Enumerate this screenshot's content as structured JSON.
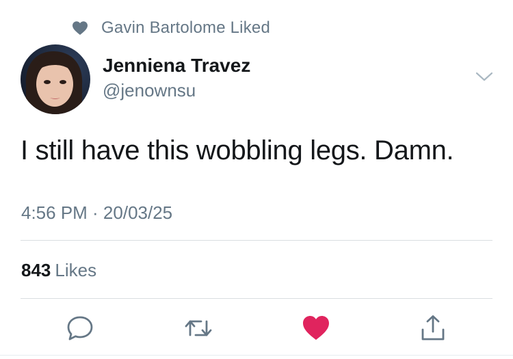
{
  "social_context": {
    "icon": "heart-icon",
    "text": "Gavin Bartolome Liked"
  },
  "author": {
    "name": "Jenniena Travez",
    "handle": "@jenownsu"
  },
  "tweet": {
    "text": "I still have this wobbling legs. Damn.",
    "timestamp": "4:56 PM · 20/03/25"
  },
  "stats": {
    "likes_count": "843",
    "likes_label": "Likes"
  },
  "actions": [
    {
      "name": "reply",
      "icon": "reply-icon"
    },
    {
      "name": "retweet",
      "icon": "retweet-icon"
    },
    {
      "name": "like",
      "icon": "heart-icon",
      "active": true
    },
    {
      "name": "share",
      "icon": "share-icon"
    }
  ],
  "colors": {
    "text_primary": "#14171a",
    "text_secondary": "#657786",
    "like_active": "#e0245e",
    "icon_gray": "#657786",
    "divider": "#d9dde1"
  }
}
